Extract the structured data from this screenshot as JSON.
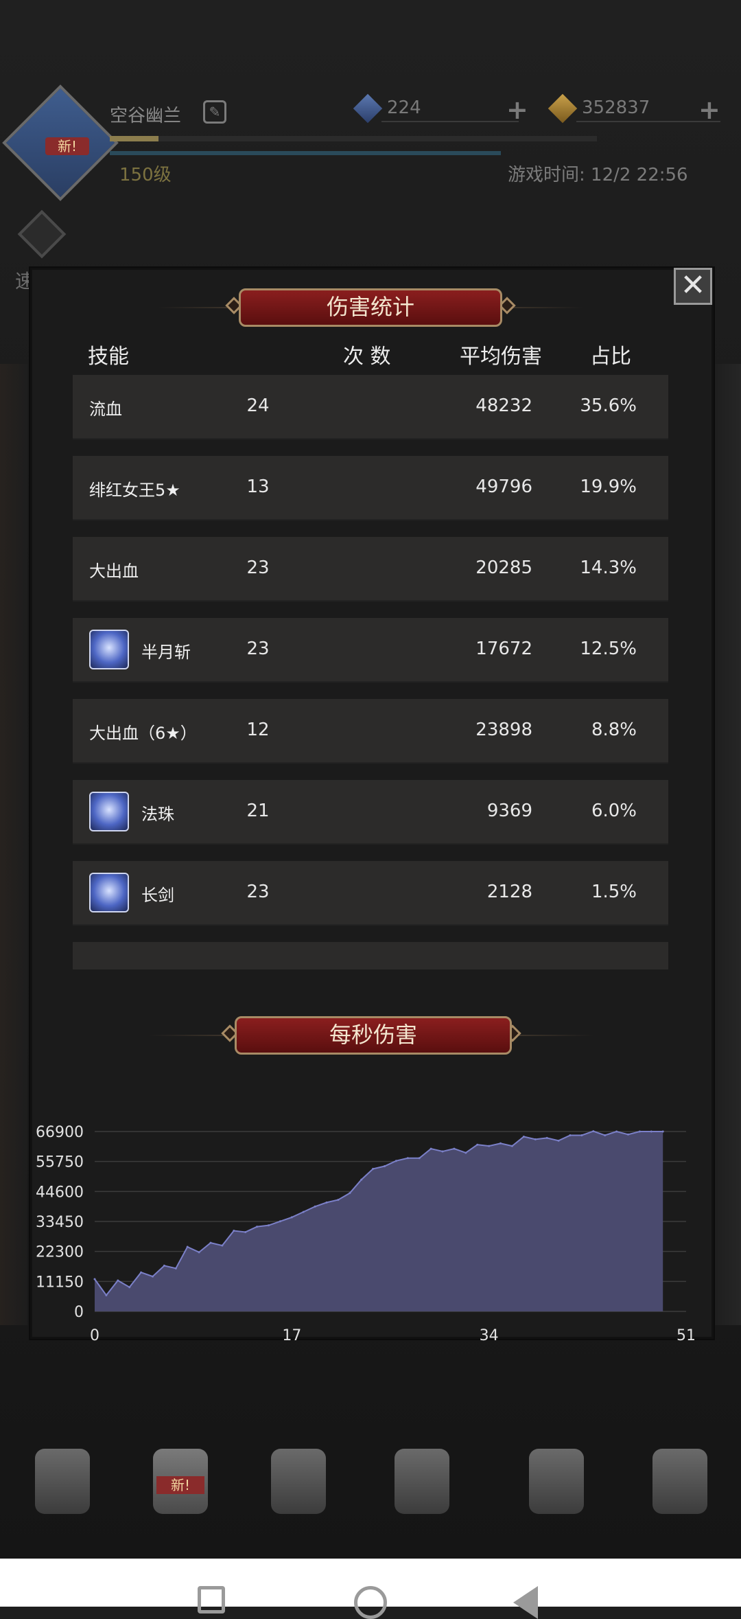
{
  "player": {
    "name": "空谷幽兰",
    "level": "150级",
    "avatar_badge": "新!"
  },
  "currency": {
    "gems": "224",
    "gold": "352837"
  },
  "game_time": "游戏时间: 12/2 22:56",
  "quick_battle": "速战",
  "bottom_nav": {
    "new_badge": "新!",
    "items": [
      "hero-icon",
      "backpack-icon",
      "equipment-icon",
      "map-icon",
      "castle-icon",
      "dice-icon"
    ]
  },
  "modal": {
    "damage_stats_title": "伤害统计",
    "dps_title": "每秒伤害",
    "close_label": "✕",
    "columns": {
      "skill": "技能",
      "count": "次 数",
      "avg": "平均伤害",
      "pct": "占比"
    },
    "rows": [
      {
        "name": "流血",
        "count": "24",
        "avg": "48232",
        "pct": "35.6%",
        "icon": ""
      },
      {
        "name": "绯红女王5★",
        "count": "13",
        "avg": "49796",
        "pct": "19.9%",
        "icon": ""
      },
      {
        "name": "大出血",
        "count": "23",
        "avg": "20285",
        "pct": "14.3%",
        "icon": ""
      },
      {
        "name": "半月斩",
        "count": "23",
        "avg": "17672",
        "pct": "12.5%",
        "icon": "crescent-moon-icon"
      },
      {
        "name": "大出血（6★）",
        "count": "12",
        "avg": "23898",
        "pct": "8.8%",
        "icon": ""
      },
      {
        "name": "法珠",
        "count": "21",
        "avg": "9369",
        "pct": "6.0%",
        "icon": "magic-orb-icon"
      },
      {
        "name": "长剑",
        "count": "23",
        "avg": "2128",
        "pct": "1.5%",
        "icon": "sword-icon"
      }
    ]
  },
  "chart_data": {
    "type": "area",
    "title": "每秒伤害",
    "xlabel": "",
    "ylabel": "",
    "xlim": [
      0,
      51
    ],
    "ylim": [
      0,
      66900
    ],
    "x_ticks": [
      "0",
      "17",
      "34",
      "51"
    ],
    "y_ticks": [
      "66900",
      "55750",
      "44600",
      "33450",
      "22300",
      "11150",
      "0"
    ],
    "grid": true,
    "fill_color": "#4a4a6e",
    "line_color": "#7b80c8",
    "series": [
      {
        "x": [
          0,
          1,
          2,
          3,
          4,
          5,
          6,
          7,
          8,
          9,
          10,
          11,
          12,
          13,
          14,
          15,
          16,
          17,
          18,
          19,
          20,
          21,
          22,
          23,
          24,
          25,
          26,
          27,
          28,
          29,
          30,
          31,
          32,
          33,
          34,
          35,
          36,
          37,
          38,
          39,
          40,
          41,
          42,
          43,
          44,
          45,
          46,
          47,
          48,
          49
        ],
        "values": [
          12000,
          6000,
          11500,
          9000,
          14500,
          13000,
          17000,
          16000,
          24000,
          22000,
          25500,
          24500,
          30000,
          29500,
          31500,
          32000,
          33500,
          35000,
          37000,
          39000,
          40500,
          41500,
          44000,
          49000,
          53000,
          54000,
          56000,
          57000,
          57000,
          60500,
          59500,
          60500,
          59000,
          62000,
          61500,
          62500,
          61500,
          65000,
          64000,
          64500,
          63500,
          65500,
          65500,
          67000,
          65500,
          66900,
          65800,
          66900,
          66900,
          66900
        ]
      }
    ]
  }
}
